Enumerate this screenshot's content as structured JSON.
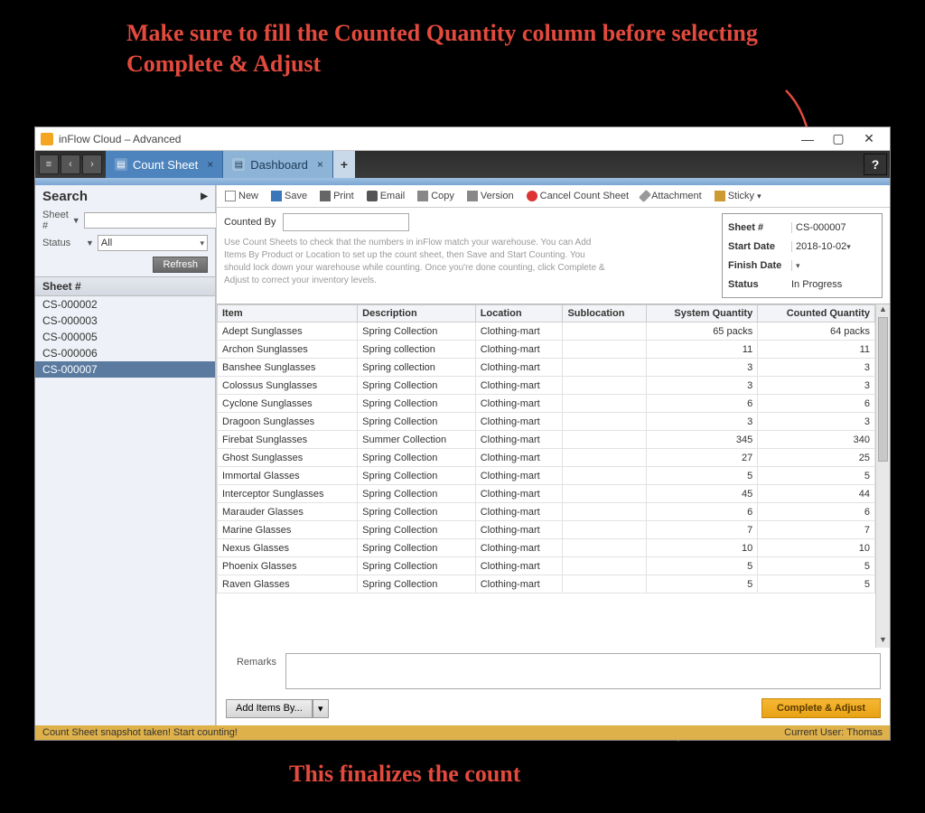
{
  "annotations": {
    "top": "Make sure to fill the Counted Quantity column before selecting Complete & Adjust",
    "bottom": "This finalizes the count"
  },
  "window": {
    "title": "inFlow Cloud – Advanced"
  },
  "tabs": [
    {
      "label": "Count Sheet",
      "icon": "bars-icon",
      "active": true
    },
    {
      "label": "Dashboard",
      "icon": "grid-icon",
      "active": false
    }
  ],
  "toolbar": [
    {
      "key": "new",
      "label": "New"
    },
    {
      "key": "save",
      "label": "Save"
    },
    {
      "key": "print",
      "label": "Print"
    },
    {
      "key": "email",
      "label": "Email"
    },
    {
      "key": "copy",
      "label": "Copy"
    },
    {
      "key": "version",
      "label": "Version"
    },
    {
      "key": "cancel",
      "label": "Cancel Count Sheet"
    },
    {
      "key": "attach",
      "label": "Attachment"
    },
    {
      "key": "sticky",
      "label": "Sticky",
      "dropdown": true
    }
  ],
  "sidebar": {
    "search_title": "Search",
    "sheet_label": "Sheet #",
    "status_label": "Status",
    "status_value": "All",
    "refresh_label": "Refresh",
    "list_header": "Sheet #",
    "items": [
      "CS-000002",
      "CS-000003",
      "CS-000005",
      "CS-000006",
      "CS-000007"
    ],
    "selected": "CS-000007"
  },
  "info": {
    "counted_by_label": "Counted By",
    "counted_by_value": "",
    "hint": "Use Count Sheets to check that the numbers in inFlow match your warehouse.  You can Add Items By Product or Location to set up the count sheet, then Save and Start Counting.  You should lock down your warehouse while counting.  Once you're done counting, click Complete & Adjust to correct your inventory levels."
  },
  "meta": {
    "sheet_label": "Sheet #",
    "sheet_value": "CS-000007",
    "start_label": "Start Date",
    "start_value": "2018-10-02",
    "finish_label": "Finish Date",
    "finish_value": "",
    "status_label": "Status",
    "status_value": "In Progress"
  },
  "grid": {
    "columns": [
      "Item",
      "Description",
      "Location",
      "Sublocation",
      "System Quantity",
      "Counted Quantity"
    ],
    "rows": [
      {
        "item": "Adept Sunglasses",
        "desc": "Spring Collection",
        "loc": "Clothing-mart",
        "sub": "",
        "sys": "65 packs",
        "cnt": "64 packs"
      },
      {
        "item": "Archon Sunglasses",
        "desc": "Spring collection",
        "loc": "Clothing-mart",
        "sub": "",
        "sys": "11",
        "cnt": "11"
      },
      {
        "item": "Banshee Sunglasses",
        "desc": "Spring collection",
        "loc": "Clothing-mart",
        "sub": "",
        "sys": "3",
        "cnt": "3"
      },
      {
        "item": "Colossus Sunglasses",
        "desc": "Spring Collection",
        "loc": "Clothing-mart",
        "sub": "",
        "sys": "3",
        "cnt": "3"
      },
      {
        "item": "Cyclone Sunglasses",
        "desc": "Spring Collection",
        "loc": "Clothing-mart",
        "sub": "",
        "sys": "6",
        "cnt": "6"
      },
      {
        "item": "Dragoon Sunglasses",
        "desc": "Spring Collection",
        "loc": "Clothing-mart",
        "sub": "",
        "sys": "3",
        "cnt": "3"
      },
      {
        "item": "Firebat Sunglasses",
        "desc": "Summer Collection",
        "loc": "Clothing-mart",
        "sub": "",
        "sys": "345",
        "cnt": "340"
      },
      {
        "item": "Ghost Sunglasses",
        "desc": "Spring Collection",
        "loc": "Clothing-mart",
        "sub": "",
        "sys": "27",
        "cnt": "25"
      },
      {
        "item": "Immortal Glasses",
        "desc": "Spring Collection",
        "loc": "Clothing-mart",
        "sub": "",
        "sys": "5",
        "cnt": "5"
      },
      {
        "item": "Interceptor Sunglasses",
        "desc": "Spring Collection",
        "loc": "Clothing-mart",
        "sub": "",
        "sys": "45",
        "cnt": "44"
      },
      {
        "item": "Marauder Glasses",
        "desc": "Spring Collection",
        "loc": "Clothing-mart",
        "sub": "",
        "sys": "6",
        "cnt": "6"
      },
      {
        "item": "Marine Glasses",
        "desc": "Spring Collection",
        "loc": "Clothing-mart",
        "sub": "",
        "sys": "7",
        "cnt": "7"
      },
      {
        "item": "Nexus Glasses",
        "desc": "Spring Collection",
        "loc": "Clothing-mart",
        "sub": "",
        "sys": "10",
        "cnt": "10"
      },
      {
        "item": "Phoenix Glasses",
        "desc": "Spring Collection",
        "loc": "Clothing-mart",
        "sub": "",
        "sys": "5",
        "cnt": "5"
      },
      {
        "item": "Raven Glasses",
        "desc": "Spring Collection",
        "loc": "Clothing-mart",
        "sub": "",
        "sys": "5",
        "cnt": "5"
      }
    ]
  },
  "remarks": {
    "label": "Remarks",
    "value": ""
  },
  "footer": {
    "add_items_label": "Add Items By...",
    "complete_label": "Complete & Adjust"
  },
  "statusbar": {
    "left": "Count Sheet snapshot taken!  Start counting!",
    "right_label": "Current User:",
    "right_value": "Thomas"
  }
}
